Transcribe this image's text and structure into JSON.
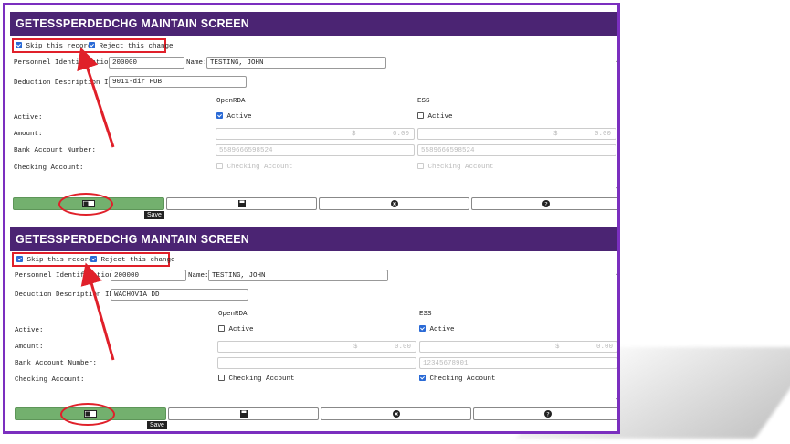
{
  "panels": [
    {
      "title": "GETESSPERDEDCHG MAINTAIN SCREEN",
      "skip_label": "Skip this record",
      "reject_label": "Reject this change",
      "personnel_label": "Personnel Identification:",
      "personnel_value": "200000",
      "name_label": "Name:",
      "name_value": "TESTING, JOHN",
      "deduction_label": "Deduction Description ID:",
      "deduction_value": "9011-dir FUB",
      "col_openrda": "OpenRDA",
      "col_ess": "ESS",
      "active_label": "Active:",
      "active_cb_label": "Active",
      "amount_label": "Amount:",
      "currency": "$",
      "amount_openrda": "0.00",
      "amount_ess": "0.00",
      "bank_label": "Bank Account Number:",
      "bank_openrda": "5589666598524",
      "bank_ess": "5589666598524",
      "checking_label": "Checking Account:",
      "checking_cb_label": "Checking Account",
      "tooltip": "Save"
    },
    {
      "title": "GETESSPERDEDCHG MAINTAIN SCREEN",
      "skip_label": "Skip this record",
      "reject_label": "Reject this change",
      "personnel_label": "Personnel Identification:",
      "personnel_value": "200000",
      "name_label": "Name:",
      "name_value": "TESTING, JOHN",
      "deduction_label": "Deduction Description ID:",
      "deduction_value": "WACHOVIA DD",
      "col_openrda": "OpenRDA",
      "col_ess": "ESS",
      "active_label": "Active:",
      "active_cb_label": "Active",
      "amount_label": "Amount:",
      "currency": "$",
      "amount_openrda": "0.00",
      "amount_ess": "0.00",
      "bank_label": "Bank Account Number:",
      "bank_openrda": "",
      "bank_ess": "12345678901",
      "checking_label": "Checking Account:",
      "checking_cb_label": "Checking Account",
      "tooltip": "Save"
    }
  ],
  "colors": {
    "title_bg": "#4b2473",
    "frame": "#7b2fbf",
    "highlight": "#e0202a",
    "save_button": "#73b06e"
  },
  "icons": [
    "id-card-icon",
    "save-disk-icon",
    "cancel-x-icon",
    "help-question-icon"
  ]
}
